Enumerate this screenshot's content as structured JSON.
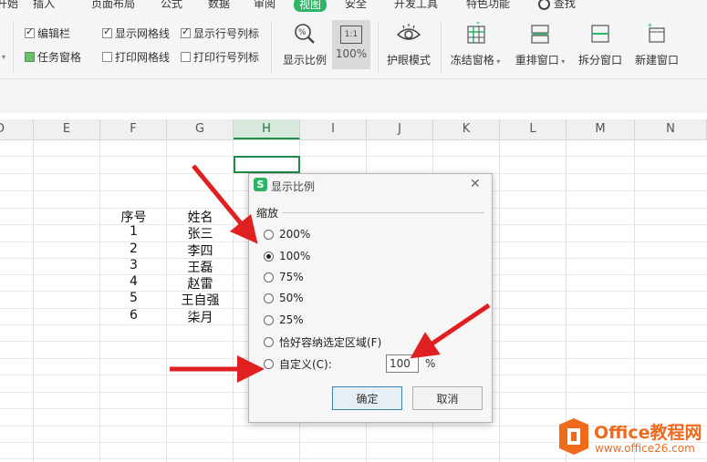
{
  "menu_tabs": [
    "开始",
    "插入",
    "页面布局",
    "公式",
    "数据",
    "审阅",
    "视图",
    "安全",
    "开发工具",
    "特色功能",
    "查找"
  ],
  "ribbon": {
    "checks": [
      {
        "label": "编辑栏",
        "checked": true
      },
      {
        "label": "任务窗格",
        "checked": false
      },
      {
        "label": "显示网格线",
        "checked": true
      },
      {
        "label": "打印网格线",
        "checked": false
      },
      {
        "label": "显示行号列标",
        "checked": true
      },
      {
        "label": "打印行号列标",
        "checked": false
      }
    ],
    "zoom_label": "显示比例",
    "zoom100_label": "100%",
    "zoom100_icon_text": "1:1",
    "eye_label": "护眼模式",
    "freeze_label": "冻结窗格",
    "rearrange_label": "重排窗口",
    "split_label": "拆分窗口",
    "new_window_label": "新建窗口"
  },
  "columns": [
    "D",
    "E",
    "F",
    "G",
    "H",
    "I",
    "J",
    "K",
    "L",
    "M",
    "N"
  ],
  "selected_column": "H",
  "table": {
    "headers": [
      "序号",
      "姓名"
    ],
    "rows": [
      [
        "1",
        "张三"
      ],
      [
        "2",
        "李四"
      ],
      [
        "3",
        "王磊"
      ],
      [
        "4",
        "赵雷"
      ],
      [
        "5",
        "王自强"
      ],
      [
        "6",
        "柒月"
      ]
    ]
  },
  "dialog": {
    "title": "显示比例",
    "group_label": "缩放",
    "options": [
      {
        "label": "200%",
        "selected": false
      },
      {
        "label": "100%",
        "selected": true
      },
      {
        "label": "75%",
        "selected": false
      },
      {
        "label": "50%",
        "selected": false
      },
      {
        "label": "25%",
        "selected": false
      },
      {
        "label": "恰好容纳选定区域(F)",
        "selected": false
      }
    ],
    "custom_label": "自定义(C):",
    "custom_value": "100",
    "custom_unit": "%",
    "ok_label": "确定",
    "cancel_label": "取消",
    "close_glyph": "✕",
    "logo_letter": "S"
  },
  "watermark": {
    "brand": "Office教程网",
    "url": "www.office26.com"
  },
  "colors": {
    "accent": "#2db567",
    "arrow": "#e02020",
    "logo_orange": "#f06a1e"
  }
}
